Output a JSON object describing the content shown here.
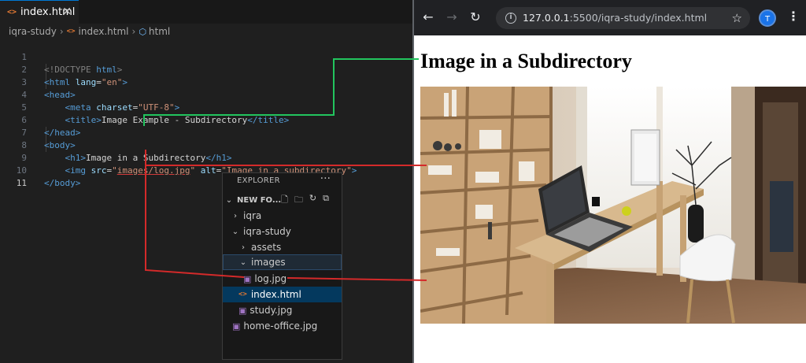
{
  "editor": {
    "tab_label": "index.html",
    "tab_close": "✕",
    "breadcrumb": [
      "iqra-study",
      "index.html",
      "html"
    ],
    "lines": [
      {
        "num": "1"
      },
      {
        "num": "2"
      },
      {
        "num": "3"
      },
      {
        "num": "4"
      },
      {
        "num": "5"
      },
      {
        "num": "6"
      },
      {
        "num": "7"
      },
      {
        "num": "8"
      },
      {
        "num": "9"
      },
      {
        "num": "10"
      },
      {
        "num": "11"
      }
    ],
    "code": {
      "doctype": "<!DOCTYPE",
      "doctype_html": "html",
      "html_open_tag": "<html",
      "lang_attr": "lang",
      "lang_value": "\"en\"",
      "head_open": "<head>",
      "meta_tag": "<meta",
      "charset_attr": "charset",
      "charset_value": "\"UTF-8\"",
      "title_open": "<title>",
      "title_text": "Image Example - Subdirectory",
      "title_close": "</title>",
      "head_close": "</head>",
      "body_open": "<body>",
      "h1_open": "<h1>",
      "h1_text": "Image in a Subdirectory",
      "h1_close": "</h1>",
      "img_tag": "<img",
      "src_attr": "src",
      "src_value": "images/log.jpg",
      "alt_attr": "alt",
      "alt_value": "\"Image in a subdirectory\"",
      "body_close": "</body>"
    }
  },
  "explorer": {
    "header": "EXPLORER",
    "more": "···",
    "root": "NEW FO...",
    "items": [
      {
        "label": "iqra",
        "type": "folder-collapsed"
      },
      {
        "label": "iqra-study",
        "type": "folder-expanded"
      },
      {
        "label": "assets",
        "type": "folder-collapsed"
      },
      {
        "label": "images",
        "type": "folder-expanded"
      },
      {
        "label": "log.jpg",
        "type": "image"
      },
      {
        "label": "index.html",
        "type": "html"
      },
      {
        "label": "study.jpg",
        "type": "image"
      },
      {
        "label": "home-office.jpg",
        "type": "image"
      }
    ]
  },
  "browser": {
    "url_host": "127.0.0.1",
    "url_rest": ":5500/iqra-study/index.html",
    "avatar_initial": "T",
    "page_heading": "Image in a Subdirectory",
    "image_alt": "Image in a subdirectory"
  },
  "colors": {
    "green_connector": "#22c55e",
    "red_connector": "#d42a2a",
    "accent": "#0078d4"
  }
}
